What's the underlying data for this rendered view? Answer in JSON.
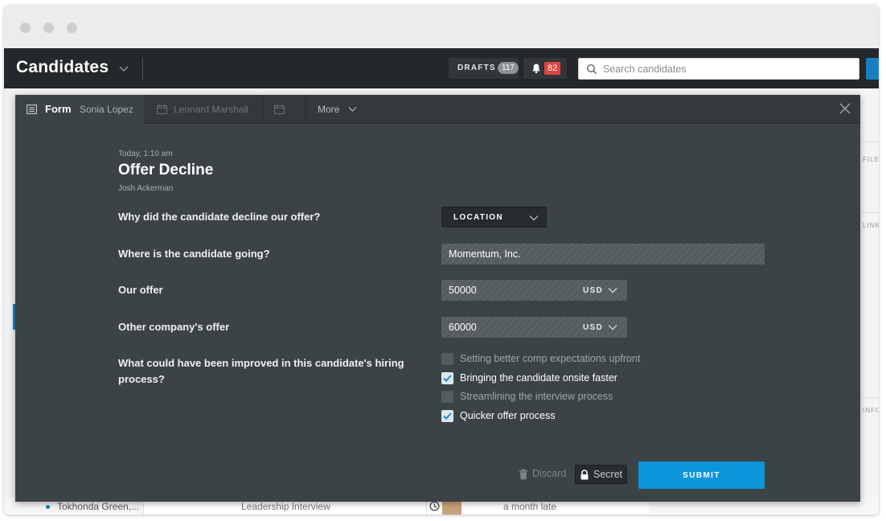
{
  "app": {
    "title": "Candidates",
    "drafts_label": "DRAFTS",
    "drafts_count": "117",
    "notifications_count": "82",
    "search_placeholder": "Search candidates"
  },
  "background": {
    "right_labels": [
      "FILE",
      "LINK",
      "INFO"
    ],
    "row_name": "Tokhonda Green,...",
    "row_stage": "Leadership Interview",
    "row_status": "a month late"
  },
  "modal": {
    "tabs": [
      {
        "title": "Form",
        "subtitle": "Sonia Lopez"
      },
      {
        "subtitle": "Leonard Marshall"
      },
      {
        "subtitle": ""
      }
    ],
    "more_label": "More"
  },
  "form": {
    "timestamp": "Today, 1:10 am",
    "title": "Offer Decline",
    "author": "Josh Ackerman",
    "questions": {
      "reason": "Why did the candidate decline our offer?",
      "destination": "Where is the candidate going?",
      "our_offer": "Our offer",
      "other_offer": "Other company's offer",
      "improve_line1": "What could have been improved in this candidate's hiring",
      "improve_line2": "process?"
    },
    "reason_value": "LOCATION",
    "destination_value": "Momentum, Inc.",
    "our_offer_value": "50000",
    "our_offer_currency": "USD",
    "other_offer_value": "60000",
    "other_offer_currency": "USD",
    "improvements": [
      {
        "label": "Setting better comp expectations upfront",
        "checked": false
      },
      {
        "label": "Bringing the candidate onsite faster",
        "checked": true
      },
      {
        "label": "Streamlining the interview process",
        "checked": false
      },
      {
        "label": "Quicker offer process",
        "checked": true
      }
    ]
  },
  "actions": {
    "discard": "Discard",
    "secret": "Secret",
    "submit": "SUBMIT"
  },
  "colors": {
    "app_bar": "#24282a",
    "modal_bg": "#3c4346",
    "accent": "#0b95d8",
    "badge": "#e0443e"
  }
}
